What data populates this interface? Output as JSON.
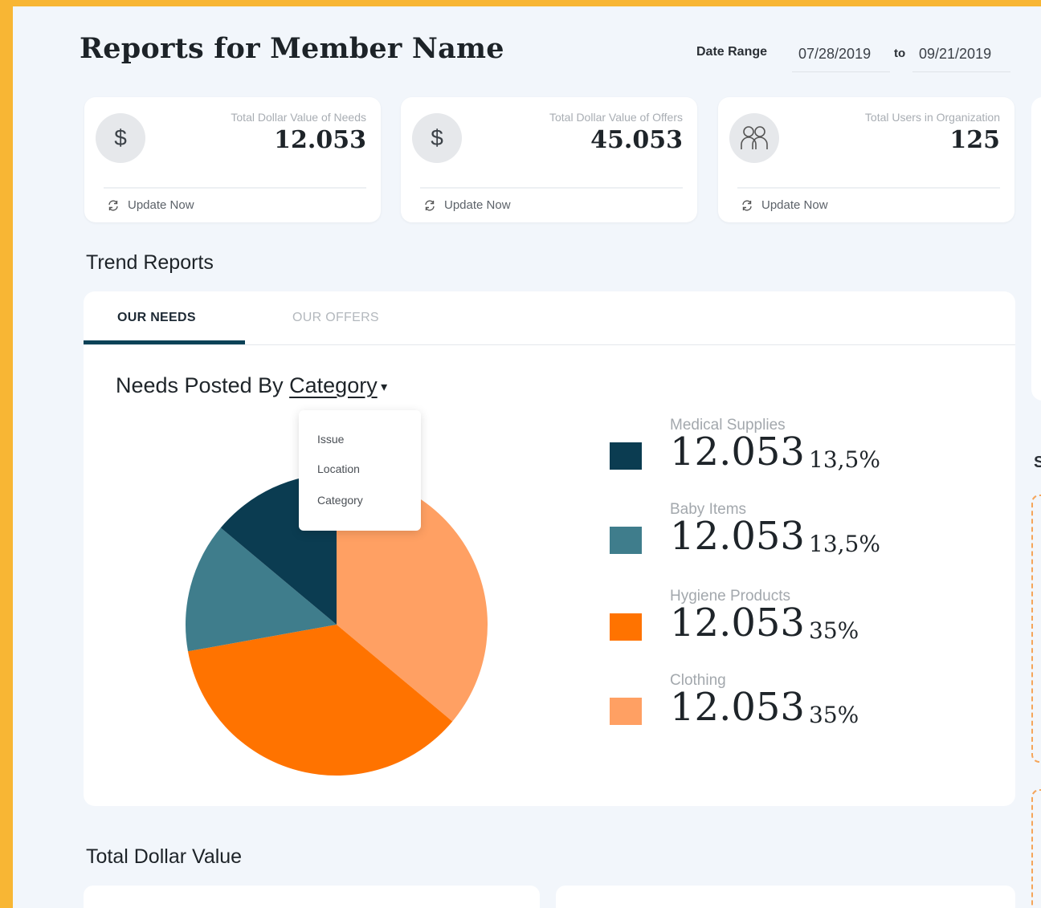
{
  "header": {
    "title": "Reports for Member Name",
    "date_range_label": "Date Range",
    "date_from": "07/28/2019",
    "to_label": "to",
    "date_to": "09/21/2019"
  },
  "stats": [
    {
      "label": "Total Dollar Value of Needs",
      "value": "12.053",
      "icon": "dollar-icon",
      "icon_glyph": "$",
      "update": "Update Now"
    },
    {
      "label": "Total Dollar Value of Offers",
      "value": "45.053",
      "icon": "dollar-icon",
      "icon_glyph": "$",
      "update": "Update Now"
    },
    {
      "label": "Total Users in Organization",
      "value": "125",
      "icon": "users-icon",
      "update": "Update Now"
    }
  ],
  "trend": {
    "title": "Trend Reports",
    "tabs": [
      {
        "label": "OUR NEEDS",
        "active": true
      },
      {
        "label": "OUR OFFERS",
        "active": false
      }
    ],
    "heading_prefix": "Needs Posted By",
    "heading_dropdown": "Category",
    "dropdown_options": [
      "Issue",
      "Location",
      "Category"
    ]
  },
  "chart_data": {
    "type": "pie",
    "title": "Needs Posted By Category",
    "categories": [
      "Medical Supplies",
      "Baby Items",
      "Hygiene Products",
      "Clothing"
    ],
    "values": [
      12.053,
      12.053,
      12.053,
      12.053
    ],
    "value_labels": [
      "12.053",
      "12.053",
      "12.053",
      "12.053"
    ],
    "percent_labels": [
      "13,5%",
      "13,5%",
      "35%",
      "35%"
    ],
    "slice_percentages": [
      13.5,
      13.5,
      35,
      35
    ],
    "colors": [
      "#0b3c51",
      "#3f7d8c",
      "#ff7300",
      "#ffa063"
    ]
  },
  "total_dollar_value": {
    "title": "Total Dollar Value"
  },
  "right_edge": {
    "partial_letter": "S"
  },
  "colors": {
    "page_bg": "#f2f6fb",
    "frame": "#f8b634",
    "accent": "#0b4257"
  }
}
